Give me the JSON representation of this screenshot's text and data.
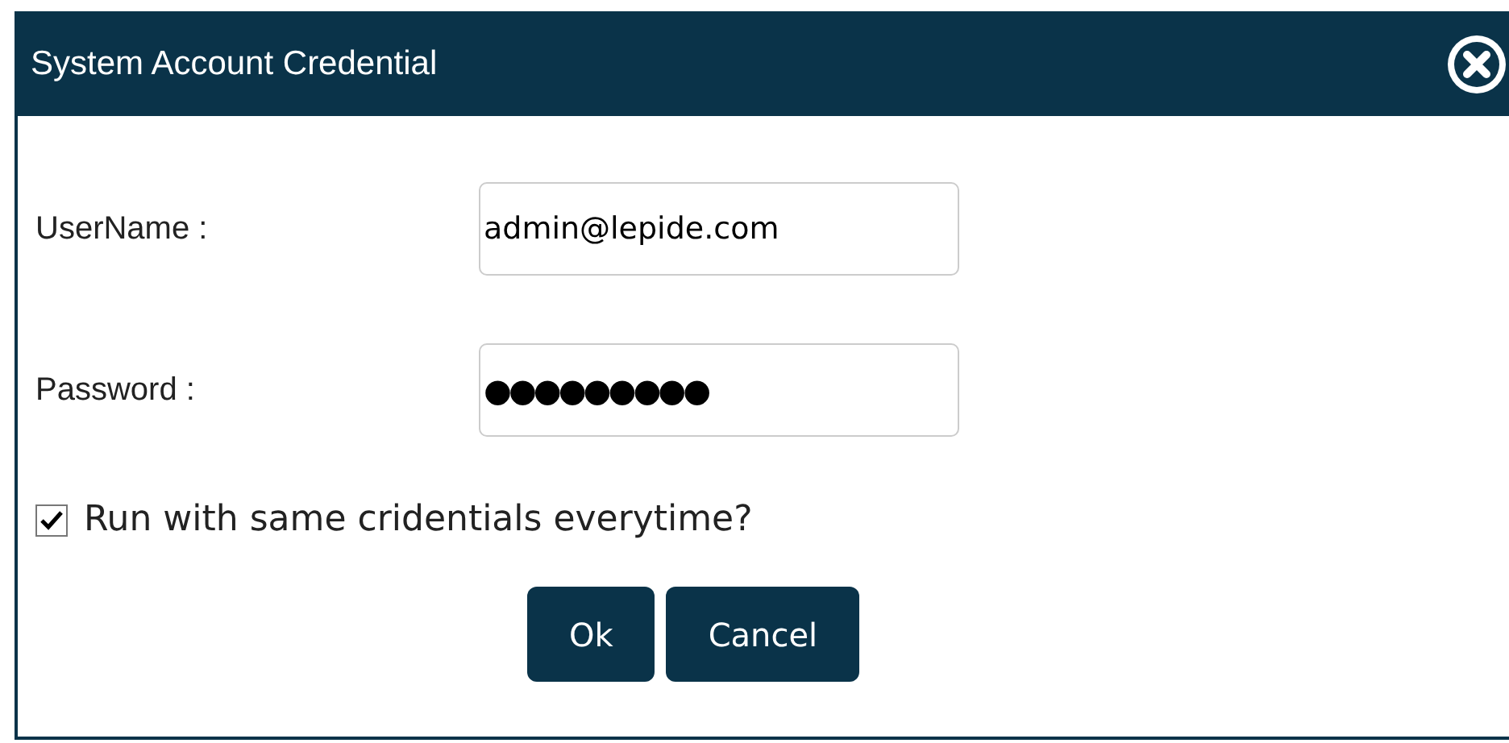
{
  "window": {
    "title": "System Account Credential"
  },
  "fields": [
    {
      "label": "UserName :",
      "value": "admin@lepide.com",
      "kind": "text"
    },
    {
      "label": "Password :",
      "value": "●●●●●●●●●",
      "kind": "password"
    }
  ],
  "checkbox": {
    "label": "Run with same cridentials everytime?",
    "checked": true
  },
  "buttons": [
    "Ok",
    "Cancel"
  ]
}
